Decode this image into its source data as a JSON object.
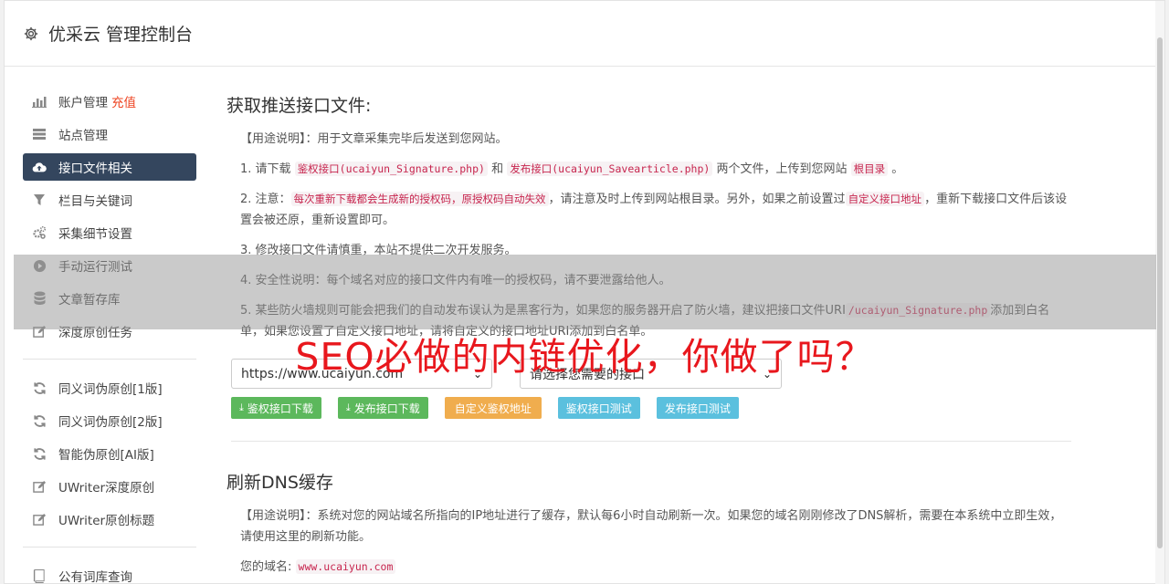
{
  "header": {
    "title": "优采云 管理控制台"
  },
  "sidebar": {
    "group1": [
      {
        "label": "账户管理",
        "badge": "充值",
        "icon": "bar-chart-icon"
      },
      {
        "label": "站点管理",
        "icon": "server-icon"
      },
      {
        "label": "接口文件相关",
        "icon": "cloud-upload-icon",
        "active": true
      },
      {
        "label": "栏目与关键词",
        "icon": "filter-icon"
      },
      {
        "label": "采集细节设置",
        "icon": "gears-icon"
      },
      {
        "label": "手动运行测试",
        "icon": "play-circle-icon"
      },
      {
        "label": "文章暂存库",
        "icon": "database-icon"
      },
      {
        "label": "深度原创任务",
        "icon": "edit-icon"
      }
    ],
    "group2": [
      {
        "label": "同义词伪原创[1版]",
        "icon": "refresh-icon"
      },
      {
        "label": "同义词伪原创[2版]",
        "icon": "refresh-icon"
      },
      {
        "label": "智能伪原创[AI版]",
        "icon": "refresh-icon"
      },
      {
        "label": "UWriter深度原创",
        "icon": "edit-icon"
      },
      {
        "label": "UWriter原创标题",
        "icon": "edit-icon"
      }
    ],
    "group3": [
      {
        "label": "公有词库查询",
        "icon": "book-icon"
      }
    ]
  },
  "section1": {
    "title": "获取推送接口文件:",
    "usage": "【用途说明】：用于文章采集完毕后发送到您网站。",
    "item1": {
      "a": "1. 请下载",
      "c1": "鉴权接口(ucaiyun_Signature.php)",
      "b": "和",
      "c2": "发布接口(ucaiyun_Savearticle.php)",
      "c": "两个文件，上传到您网站",
      "c3": "根目录",
      "d": "。"
    },
    "item2": {
      "a": "2. 注意：",
      "c1": "每次重新下载都会生成新的授权码，原授权码自动失效",
      "b": "，请注意及时上传到网站根目录。另外，如果之前设置过",
      "c2": "自定义接口地址",
      "c": "，重新下载接口文件后该设置会被还原，重新设置即可。"
    },
    "item3": "3. 修改接口文件请慎重，本站不提供二次开发服务。",
    "item4": "4. 安全性说明：每个域名对应的接口文件内有唯一的授权码，请不要泄露给他人。",
    "item5": {
      "a": "5. 某些防火墙规则可能会把我们的自动发布误认为是黑客行为，如果您的服务器开启了防火墙，建议把接口文件URI",
      "c1": "/ucaiyun_Signature.php",
      "b": "添加到白名单，如果您设置了自定义接口地址，请将自定义的接口地址URI添加到白名单。"
    },
    "select_site": "https://www.ucaiyun.com",
    "select_api": "请选择您需要的接口",
    "buttons": [
      "鉴权接口下载",
      "发布接口下载",
      "自定义鉴权地址",
      "鉴权接口测试",
      "发布接口测试"
    ]
  },
  "section2": {
    "title": "刷新DNS缓存",
    "usage": "【用途说明】：系统对您的网站域名所指向的IP地址进行了缓存，默认每6小时自动刷新一次。如果您的域名刚刚修改了DNS解析，需要在本系统中立即生效，请使用这里的刷新功能。",
    "domain_label": "您的域名:",
    "domain_value": "www.ucaiyun.com"
  },
  "overlay": {
    "headline": "SEO必做的内链优化，你做了吗？"
  }
}
